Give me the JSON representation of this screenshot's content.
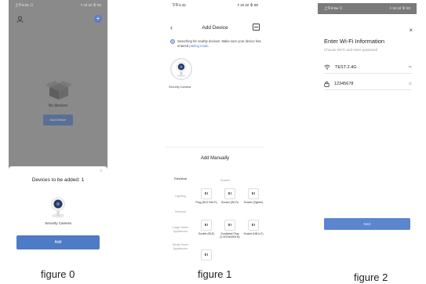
{
  "figures": [
    {
      "caption": "figure 0",
      "status": {
        "time": "上午9:56 ⊙",
        "right": "ｷ 3ıl 3ıl 令 80"
      },
      "home": {
        "empty_text": "No devices",
        "add_device_label": "Add Device"
      },
      "sheet": {
        "title": "Devices to be added: 1",
        "device_name": "Security Camera",
        "add_label": "Add",
        "close_glyph": "×"
      },
      "icons": [
        "user-icon",
        "add-icon",
        "empty-box-icon",
        "camera-icon"
      ],
      "colors": {
        "overlay": "#8a8a8a",
        "primary": "#4e7bc6"
      }
    },
    {
      "caption": "figure 1",
      "status": {
        "time": "下午4:42",
        "right": "ｷ 3ıl 3ıl 令 80"
      },
      "header": {
        "back_glyph": "‹",
        "title": "Add Device"
      },
      "searching": {
        "text": "Searching for nearby devices. Make sure your device has entered",
        "link": "pairing mode."
      },
      "found": {
        "label": "Security Camera"
      },
      "manual": {
        "title": "Add Manually",
        "categories": [
          "Electrical",
          "Lighting",
          "Sensors",
          "Large Home Appliances",
          "Small Home Appliances"
        ],
        "subheading": "Socket",
        "devices": [
          {
            "name": "Plug (BLE+Wi-Fi)"
          },
          {
            "name": "Socket (Wi-Fi)"
          },
          {
            "name": "Socket (Zigbee)"
          },
          {
            "name": "Socket (BLE)"
          },
          {
            "name": "Dualband Plug (2.4GHz&5GHz)"
          },
          {
            "name": "Socket (NB-IoT)"
          },
          {
            "name": ""
          }
        ]
      },
      "colors": {
        "primary": "#4e7bc6"
      }
    },
    {
      "caption": "figure 2",
      "status": {
        "time": "上午9:5● ⊙",
        "right": "ｷ 3ıl 3ıl 令 80"
      },
      "title": "Enter Wi-Fi Information",
      "subtitle": "Choose Wi-Fi and enter password",
      "wifi": {
        "ssid": "TEST-2.4G",
        "trailing_glyph": "⇋"
      },
      "password": {
        "value": "12345678",
        "trailing_glyph": "⊙"
      },
      "close_glyph": "×",
      "next_label": "Next",
      "colors": {
        "primary": "#5b85cf"
      }
    }
  ]
}
